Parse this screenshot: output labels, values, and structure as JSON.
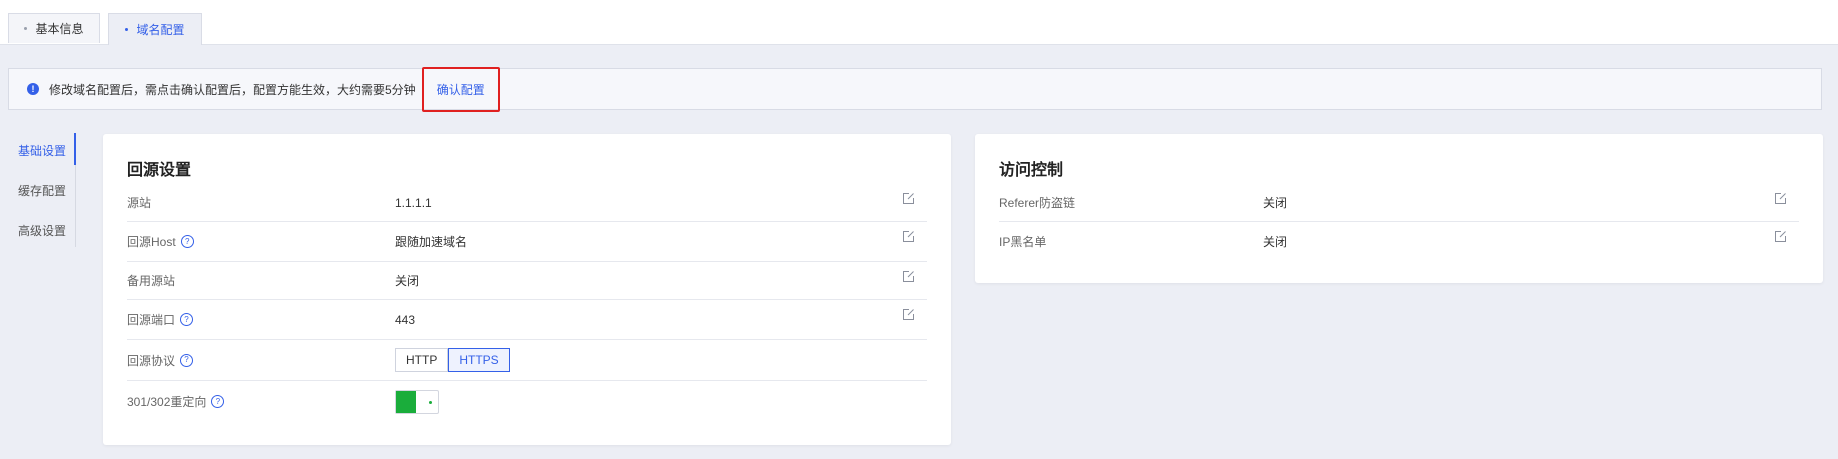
{
  "tabs": [
    {
      "label": "基本信息",
      "active": false
    },
    {
      "label": "域名配置",
      "active": true
    }
  ],
  "notice": {
    "message": "修改域名配置后，需点击确认配置后，配置方能生效，大约需要5分钟",
    "confirm_label": "确认配置"
  },
  "side_menu": {
    "items": [
      {
        "label": "基础设置",
        "active": true
      },
      {
        "label": "缓存配置",
        "active": false
      },
      {
        "label": "高级设置",
        "active": false
      }
    ]
  },
  "origin_card": {
    "title": "回源设置",
    "rows": {
      "origin": {
        "label": "源站",
        "value": "1.1.1.1"
      },
      "host": {
        "label": "回源Host",
        "value": "跟随加速域名"
      },
      "backup": {
        "label": "备用源站",
        "value": "关闭"
      },
      "port": {
        "label": "回源端口",
        "value": "443"
      },
      "protocol": {
        "label": "回源协议",
        "options": [
          "HTTP",
          "HTTPS"
        ],
        "selected": "HTTPS"
      },
      "redirect": {
        "label": "301/302重定向",
        "enabled": true
      }
    }
  },
  "access_card": {
    "title": "访问控制",
    "rows": {
      "referer": {
        "label": "Referer防盗链",
        "value": "关闭"
      },
      "ip_blacklist": {
        "label": "IP黑名单",
        "value": "关闭"
      }
    }
  },
  "colors": {
    "accent": "#3460e8",
    "highlight_border": "#e02020",
    "toggle_on": "#1aad3b",
    "page_bg": "#eceef5"
  }
}
